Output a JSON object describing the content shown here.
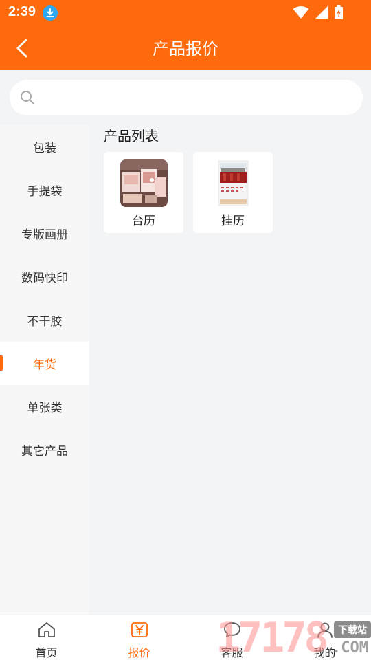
{
  "status_bar": {
    "time": "2:39"
  },
  "header": {
    "title": "产品报价"
  },
  "search": {
    "placeholder": ""
  },
  "sidebar": {
    "items": [
      {
        "label": "包装",
        "active": false
      },
      {
        "label": "手提袋",
        "active": false
      },
      {
        "label": "专版画册",
        "active": false
      },
      {
        "label": "数码快印",
        "active": false
      },
      {
        "label": "不干胶",
        "active": false
      },
      {
        "label": "年货",
        "active": true
      },
      {
        "label": "单张类",
        "active": false
      },
      {
        "label": "其它产品",
        "active": false
      }
    ]
  },
  "content": {
    "section_title": "产品列表",
    "products": [
      {
        "label": "台历"
      },
      {
        "label": "挂历"
      }
    ]
  },
  "tabbar": {
    "items": [
      {
        "label": "首页",
        "icon": "home-icon",
        "active": false
      },
      {
        "label": "报价",
        "icon": "yen-icon",
        "active": true
      },
      {
        "label": "客服",
        "icon": "chat-icon",
        "active": false
      },
      {
        "label": "我的",
        "icon": "user-icon",
        "active": false
      }
    ]
  },
  "watermark": {
    "number": "17178",
    "badge": "下载站",
    "suffix": ".COM"
  },
  "colors": {
    "accent": "#ff6a0c",
    "background": "#f3f4f6"
  }
}
